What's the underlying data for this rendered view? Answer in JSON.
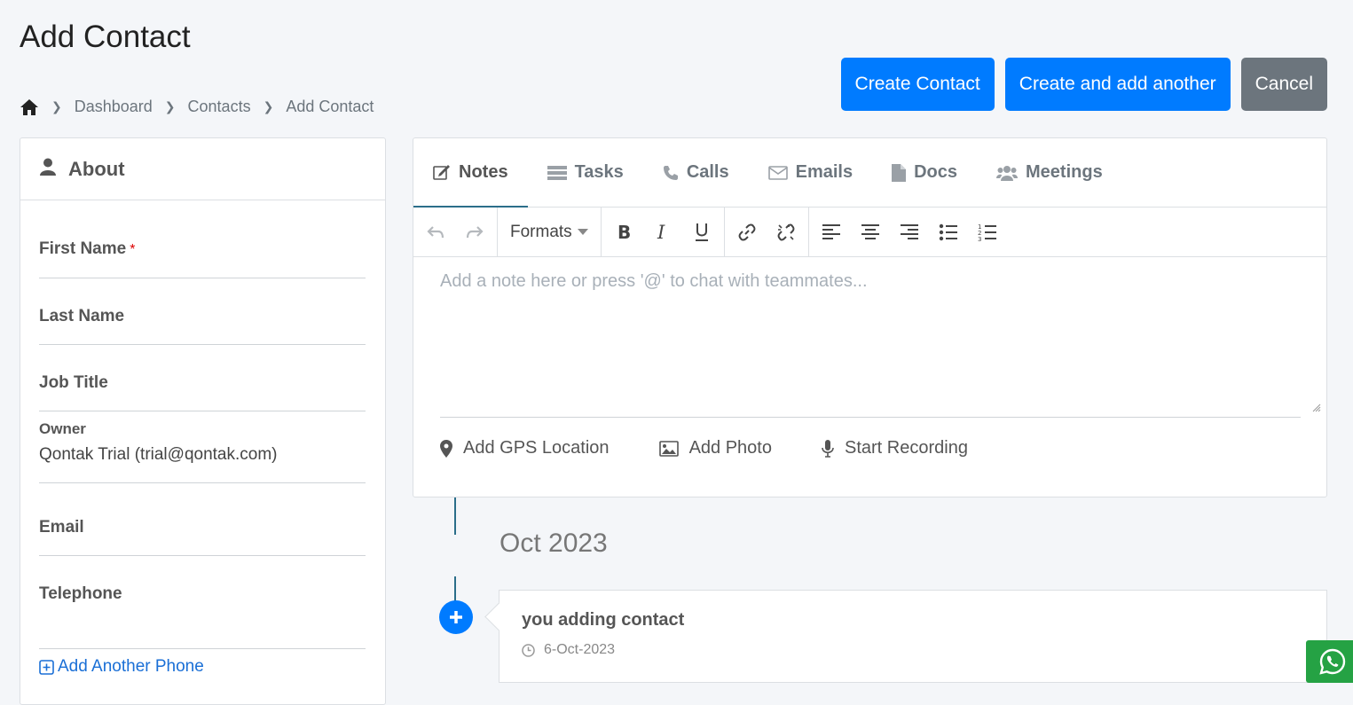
{
  "page": {
    "title": "Add Contact"
  },
  "breadcrumb": {
    "items": [
      "Dashboard",
      "Contacts",
      "Add Contact"
    ]
  },
  "actions": {
    "create": "Create Contact",
    "create_another": "Create and add another",
    "cancel": "Cancel"
  },
  "about": {
    "title": "About",
    "fields": {
      "first_name": "First Name",
      "required_marker": "*",
      "last_name": "Last Name",
      "job_title": "Job Title",
      "owner_label": "Owner",
      "owner_value": "Qontak Trial (trial@qontak.com)",
      "email": "Email",
      "telephone": "Telephone"
    },
    "add_phone": "Add Another Phone"
  },
  "tabs": [
    "Notes",
    "Tasks",
    "Calls",
    "Emails",
    "Docs",
    "Meetings"
  ],
  "toolbar": {
    "formats": "Formats"
  },
  "editor": {
    "placeholder": "Add a note here or press '@' to chat with teammates..."
  },
  "note_actions": {
    "gps": "Add GPS Location",
    "photo": "Add Photo",
    "record": "Start Recording"
  },
  "timeline": {
    "month": "Oct 2023",
    "entry_title": "you adding contact",
    "entry_date": "6-Oct-2023"
  },
  "colors": {
    "primary": "#007bff",
    "secondary": "#6c757d",
    "timeline": "#2b6e8a",
    "whatsapp": "#25a244"
  }
}
